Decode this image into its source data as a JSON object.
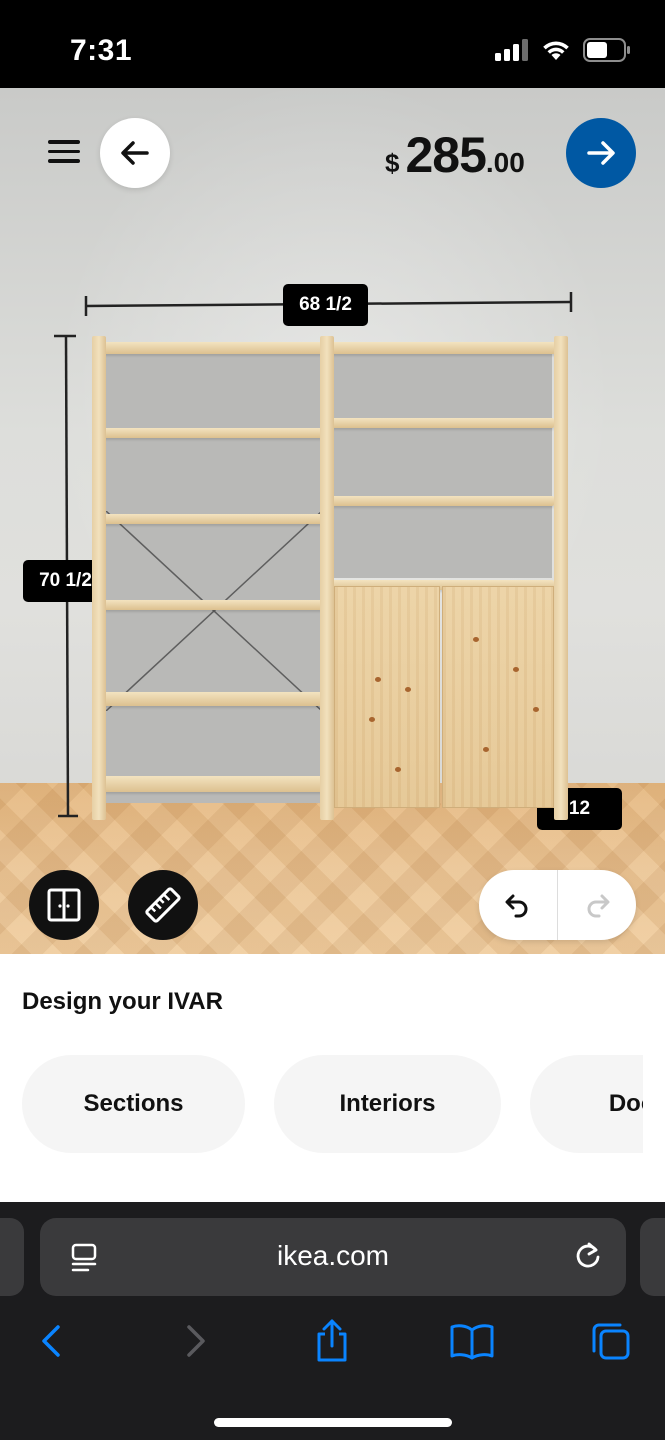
{
  "status_bar": {
    "time": "7:31"
  },
  "header": {
    "price_currency": "$",
    "price_main": "285",
    "price_cents": ".00"
  },
  "dimensions": {
    "width": "68 1/2",
    "height": "70 1/2",
    "depth": "12"
  },
  "icons": {
    "menu": "hamburger-menu-icon",
    "back": "arrow-left-icon",
    "next": "arrow-right-icon",
    "sections_view": "split-panel-icon",
    "measure": "ruler-icon",
    "undo": "undo-icon",
    "redo": "redo-icon"
  },
  "colors": {
    "accent_blue": "#0058a3",
    "panel_bg": "#ffffff",
    "pill_bg": "#f5f5f5",
    "browser_bg": "#1c1c1e",
    "ios_link_blue": "#0a84ff"
  },
  "panel": {
    "title": "Design your IVAR",
    "tabs": [
      {
        "label": "Sections"
      },
      {
        "label": "Interiors"
      },
      {
        "label": "Doors"
      }
    ]
  },
  "browser": {
    "url": "ikea.com"
  }
}
